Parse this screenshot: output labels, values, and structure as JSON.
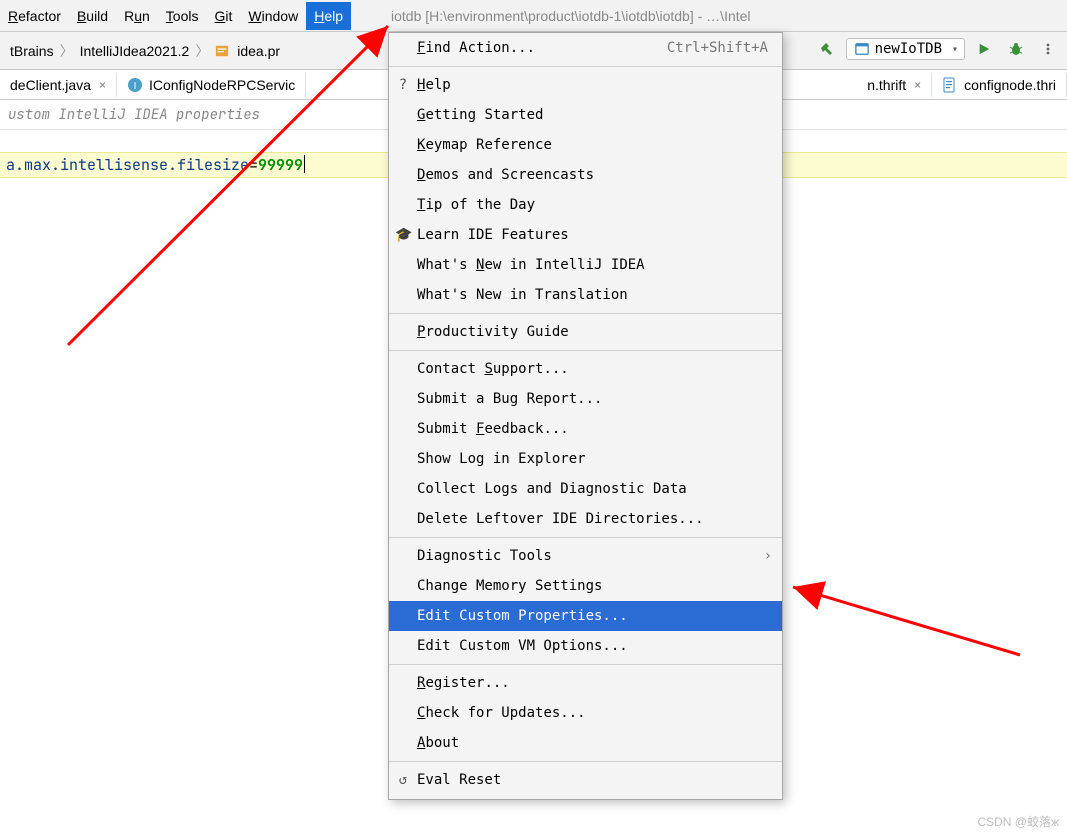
{
  "menubar": {
    "items": [
      "Refactor",
      "Build",
      "Run",
      "Tools",
      "Git",
      "Window",
      "Help"
    ],
    "underlines": [
      "R",
      "B",
      "u",
      "T",
      "G",
      "W",
      "H"
    ],
    "active_index": 6,
    "window_title": "iotdb [H:\\environment\\product\\iotdb-1\\iotdb\\iotdb] - …\\Intel"
  },
  "breadcrumb": {
    "items": [
      "tBrains",
      "IntelliJIdea2021.2",
      "idea.pr"
    ]
  },
  "toolbar": {
    "run_config": "newIoTDB",
    "run_tooltip": "Run",
    "debug_tooltip": "Debug",
    "more_tooltip": "More"
  },
  "tabs": {
    "left": [
      {
        "label": "deClient.java",
        "icon": "java-icon"
      },
      {
        "label": "IConfigNodeRPCServic",
        "icon": "java-icon"
      }
    ],
    "right": [
      {
        "label": "n.thrift",
        "icon": "thrift-icon"
      },
      {
        "label": "confignode.thri",
        "icon": "thrift-icon"
      }
    ]
  },
  "banner": "ustom IntelliJ IDEA properties",
  "code": {
    "key": "a.max.intellisense.filesize",
    "eq": "=",
    "value": "99999"
  },
  "menu": {
    "items": [
      {
        "label": "Find Action...",
        "u": "F",
        "shortcut": "Ctrl+Shift+A"
      },
      {
        "sep": true
      },
      {
        "label": "Help",
        "u": "H",
        "lead": "?"
      },
      {
        "label": "Getting Started",
        "u": "G"
      },
      {
        "label": "Keymap Reference",
        "u": "K"
      },
      {
        "label": "Demos and Screencasts",
        "u": "D"
      },
      {
        "label": "Tip of the Day",
        "u": "T"
      },
      {
        "label": "Learn IDE Features",
        "lead": "🎓"
      },
      {
        "label": "What's New in IntelliJ IDEA",
        "u": "N"
      },
      {
        "label": "What's New in Translation"
      },
      {
        "sep": true
      },
      {
        "label": "Productivity Guide",
        "u": "P"
      },
      {
        "sep": true
      },
      {
        "label": "Contact Support...",
        "u": "S"
      },
      {
        "label": "Submit a Bug Report..."
      },
      {
        "label": "Submit Feedback...",
        "u": "F"
      },
      {
        "label": "Show Log in Explorer"
      },
      {
        "label": "Collect Logs and Diagnostic Data"
      },
      {
        "label": "Delete Leftover IDE Directories..."
      },
      {
        "sep": true
      },
      {
        "label": "Diagnostic Tools",
        "arrow": true
      },
      {
        "label": "Change Memory Settings"
      },
      {
        "label": "Edit Custom Properties...",
        "selected": true
      },
      {
        "label": "Edit Custom VM Options..."
      },
      {
        "sep": true
      },
      {
        "label": "Register...",
        "u": "R"
      },
      {
        "label": "Check for Updates...",
        "u": "C"
      },
      {
        "label": "About",
        "u": "A"
      },
      {
        "sep": true
      },
      {
        "label": "Eval Reset",
        "lead": "↺"
      }
    ]
  },
  "watermark": "CSDN @蛟落ж"
}
